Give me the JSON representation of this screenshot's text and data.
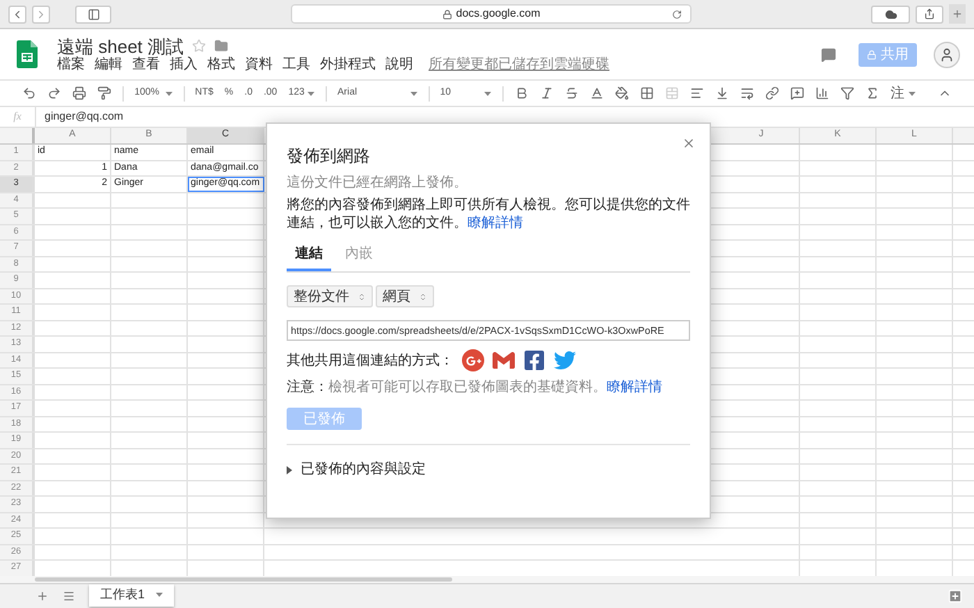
{
  "browser": {
    "url": "docs.google.com"
  },
  "doc": {
    "title": "遠端 sheet 測試",
    "menus": [
      "檔案",
      "編輯",
      "查看",
      "插入",
      "格式",
      "資料",
      "工具",
      "外掛程式",
      "說明"
    ],
    "save_status": "所有變更都已儲存到雲端硬碟",
    "share_button": "共用"
  },
  "toolbar": {
    "zoom": "100%",
    "currency": "NT$",
    "percent": "%",
    "decrease_decimals": ".0",
    "increase_decimals": ".00",
    "number_format": "123",
    "font": "Arial",
    "font_size": "10",
    "input_tools": "注"
  },
  "formula_bar": {
    "label": "fx",
    "value": "ginger@qq.com"
  },
  "grid": {
    "left_columns": [
      {
        "label": "A",
        "selected": false
      },
      {
        "label": "B",
        "selected": false
      },
      {
        "label": "C",
        "selected": true
      }
    ],
    "right_columns": [
      {
        "label": "J",
        "selected": false
      },
      {
        "label": "K",
        "selected": false
      },
      {
        "label": "L",
        "selected": false
      }
    ],
    "rows": [
      {
        "number": "1",
        "selected": false,
        "cells": [
          {
            "text": "id",
            "kind": "text",
            "selected": false
          },
          {
            "text": "name",
            "kind": "text",
            "selected": false
          },
          {
            "text": "email",
            "kind": "text",
            "selected": false
          }
        ]
      },
      {
        "number": "2",
        "selected": false,
        "cells": [
          {
            "text": "1",
            "kind": "number",
            "selected": false
          },
          {
            "text": "Dana",
            "kind": "text",
            "selected": false
          },
          {
            "text": "dana@gmail.co",
            "kind": "text",
            "selected": false
          }
        ]
      },
      {
        "number": "3",
        "selected": true,
        "cells": [
          {
            "text": "2",
            "kind": "number",
            "selected": false
          },
          {
            "text": "Ginger",
            "kind": "text",
            "selected": false
          },
          {
            "text": "ginger@qq.com",
            "kind": "text",
            "selected": true
          }
        ]
      },
      {
        "number": "4",
        "selected": false
      },
      {
        "number": "5",
        "selected": false
      },
      {
        "number": "6",
        "selected": false
      },
      {
        "number": "7",
        "selected": false
      },
      {
        "number": "8",
        "selected": false
      },
      {
        "number": "9",
        "selected": false
      },
      {
        "number": "10",
        "selected": false
      },
      {
        "number": "11",
        "selected": false
      },
      {
        "number": "12",
        "selected": false
      },
      {
        "number": "13",
        "selected": false
      },
      {
        "number": "14",
        "selected": false
      },
      {
        "number": "15",
        "selected": false
      },
      {
        "number": "16",
        "selected": false
      },
      {
        "number": "17",
        "selected": false
      },
      {
        "number": "18",
        "selected": false
      },
      {
        "number": "19",
        "selected": false
      },
      {
        "number": "20",
        "selected": false
      },
      {
        "number": "21",
        "selected": false
      },
      {
        "number": "22",
        "selected": false
      },
      {
        "number": "23",
        "selected": false
      },
      {
        "number": "24",
        "selected": false
      },
      {
        "number": "25",
        "selected": false
      },
      {
        "number": "26",
        "selected": false
      },
      {
        "number": "27",
        "selected": false
      }
    ]
  },
  "sheet_tabs": [
    {
      "label": "工作表1",
      "selected": true
    }
  ],
  "dialog": {
    "title": "發佈到網路",
    "status": "這份文件已經在網路上發佈。",
    "description": "將您的內容發佈到網路上即可供所有人檢視。您可以提供您的文件連結，也可以嵌入您的文件。",
    "description_link": "瞭解詳情",
    "tabs": [
      {
        "label": "連結",
        "selected": true
      },
      {
        "label": "內嵌",
        "selected": false
      }
    ],
    "selects": [
      "整份文件",
      "網頁"
    ],
    "url": "https://docs.google.com/spreadsheets/d/e/2PACX-1vSqsSxmD1CcWO-k3OxwPoRE",
    "share_label": "其他共用這個連結的方式：",
    "share_targets": [
      {
        "kind": "googleplus"
      },
      {
        "kind": "gmail"
      },
      {
        "kind": "facebook"
      },
      {
        "kind": "twitter"
      }
    ],
    "note": "**注意：**檢視者可能可以存取已發佈圖表的基礎資料。",
    "note_link": "瞭解詳情",
    "publish_button": {
      "label": "已發佈",
      "disabled": true
    },
    "section": {
      "label": "已發佈的內容與設定",
      "expanded": false
    }
  }
}
